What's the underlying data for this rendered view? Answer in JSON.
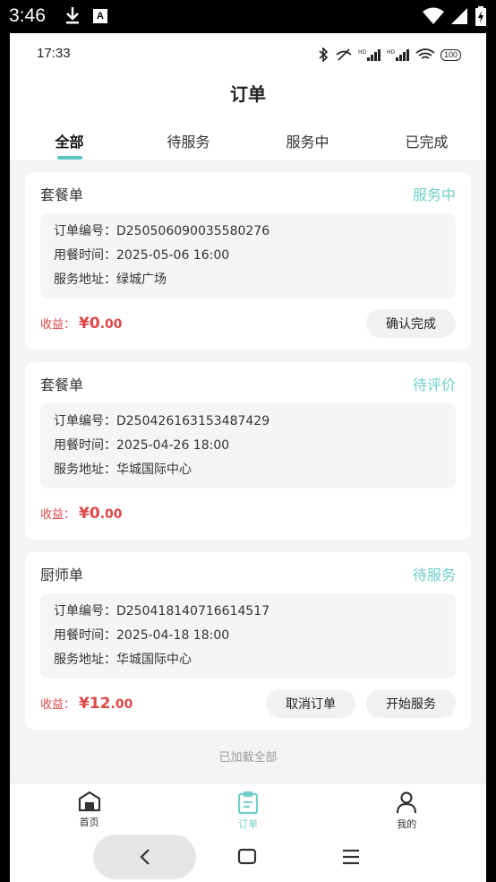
{
  "system": {
    "time": "3:46",
    "a_badge": "A"
  },
  "status": {
    "time": "17:33",
    "battery": "100"
  },
  "title": "订单",
  "tabs": [
    {
      "label": "全部"
    },
    {
      "label": "待服务"
    },
    {
      "label": "服务中"
    },
    {
      "label": "已完成"
    }
  ],
  "orders": [
    {
      "type": "套餐单",
      "status": "服务中",
      "order_no": "订单编号：D250506090035580276",
      "meal_time": "用餐时间：2025-05-06 16:00",
      "address": "服务地址：绿城广场",
      "income_label": "收益：",
      "income_int": "¥0",
      "income_dec": ".00",
      "buttons": [
        "确认完成"
      ]
    },
    {
      "type": "套餐单",
      "status": "待评价",
      "order_no": "订单编号：D250426163153487429",
      "meal_time": "用餐时间：2025-04-26 18:00",
      "address": "服务地址：华城国际中心",
      "income_label": "收益：",
      "income_int": "¥0",
      "income_dec": ".00",
      "buttons": []
    },
    {
      "type": "厨师单",
      "status": "待服务",
      "order_no": "订单编号：D250418140716614517",
      "meal_time": "用餐时间：2025-04-18 18:00",
      "address": "服务地址：华城国际中心",
      "income_label": "收益：",
      "income_int": "¥12",
      "income_dec": ".00",
      "buttons": [
        "取消订单",
        "开始服务"
      ]
    }
  ],
  "loaded_all": "已加载全部",
  "tabbar": [
    {
      "label": "首页",
      "icon": "home-icon"
    },
    {
      "label": "订单",
      "icon": "order-icon"
    },
    {
      "label": "我的",
      "icon": "profile-icon"
    }
  ],
  "colors": {
    "accent": "#6fcfc8",
    "income": "#e04646"
  }
}
